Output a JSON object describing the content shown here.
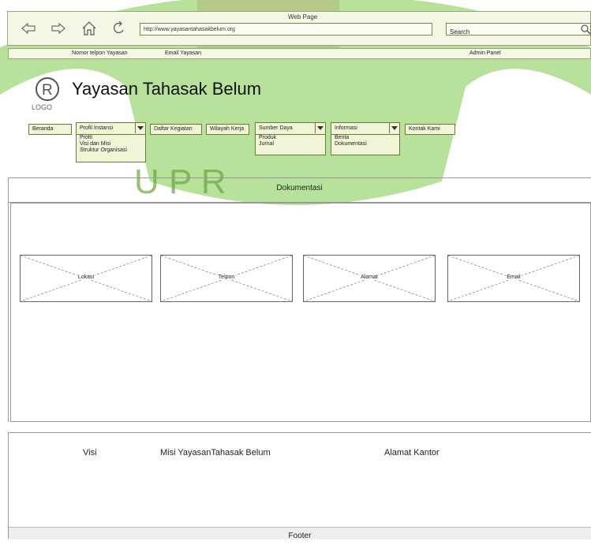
{
  "browser": {
    "window_title": "Web Page",
    "url": "http://www.yayasantahasakbelum.org",
    "search_placeholder": "Search"
  },
  "infobar": {
    "phone": "Nomor telpon Yayasan",
    "email": "Email Yayasan",
    "admin": "Admin Panel"
  },
  "watermark": {
    "text": "U P R"
  },
  "logo": {
    "label": "LOGO"
  },
  "site": {
    "title": "Yayasan Tahasak Belum"
  },
  "nav": {
    "beranda": "Beranda",
    "profil": {
      "label": "Profil Instansi",
      "items": [
        "Profil",
        "Visi dan Misi",
        "Struktur Organisasi"
      ]
    },
    "kegiatan": "Daftar Kegiatan",
    "wilayah": "Wilayah Kerja",
    "sumber": {
      "label": "Sumber Daya",
      "items": [
        "Produk",
        "Jurnal"
      ]
    },
    "informasi": {
      "label": "Informasi",
      "items": [
        "Berita",
        "Dokumentasi"
      ]
    },
    "kontak": "Kontak Kami"
  },
  "section": {
    "title": "Dokumentasi"
  },
  "placeholders": [
    "Lokasi",
    "Telpon",
    "Alamat",
    "Email"
  ],
  "bottom": {
    "visi": "Visi",
    "misi": "Misi YayasanTahasak Belum",
    "alamat": "Alamat Kantor"
  },
  "footer": {
    "label": "Footer"
  },
  "colors": {
    "chrome_bg": "#f4f7e6",
    "border": "#9aa67a",
    "watermark_green": "#7ec84a"
  }
}
